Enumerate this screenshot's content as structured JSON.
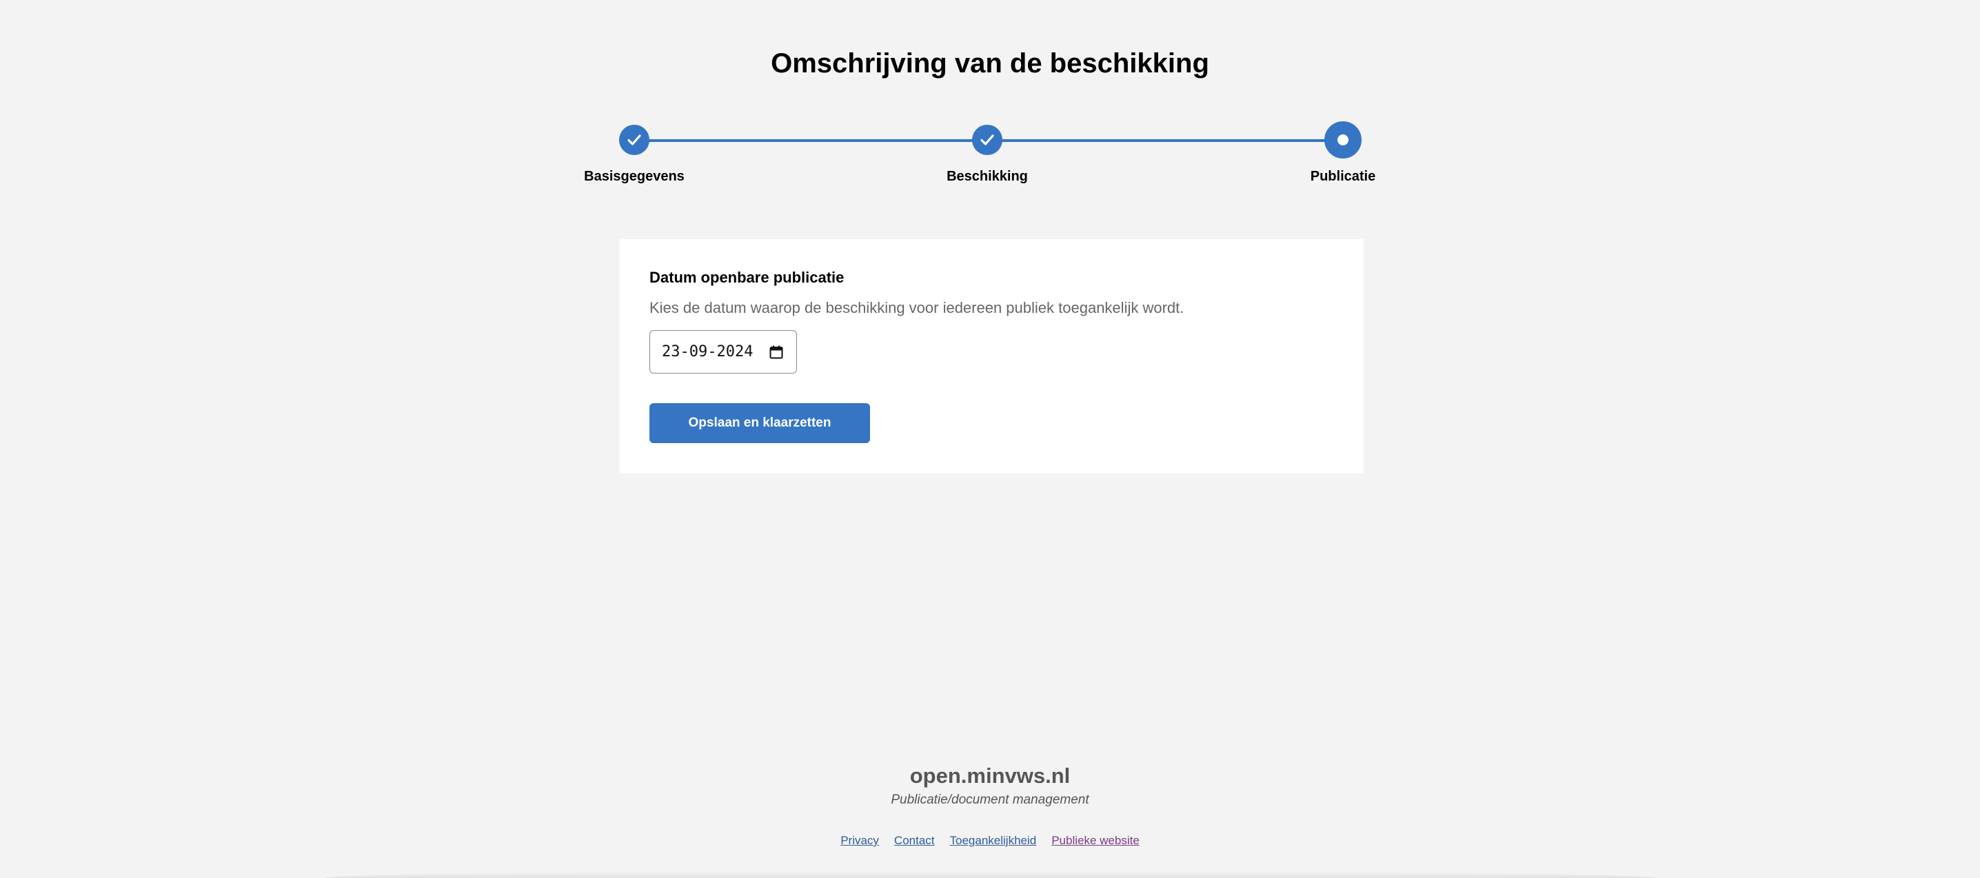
{
  "page": {
    "title": "Omschrijving van de beschikking"
  },
  "stepper": {
    "accent_color": "#3575c3",
    "steps": [
      {
        "label": "Basisgegevens",
        "state": "completed",
        "icon": "check-icon"
      },
      {
        "label": "Beschikking",
        "state": "completed",
        "icon": "check-icon"
      },
      {
        "label": "Publicatie",
        "state": "current",
        "icon": "current-dot-icon"
      }
    ]
  },
  "form": {
    "label": "Datum openbare publicatie",
    "help": "Kies de datum waarop de beschikking voor iedereen publiek toegankelijk wordt.",
    "date_value": "23-09-2024",
    "date_icon": "calendar-icon",
    "submit_label": "Opslaan en klaarzetten"
  },
  "footer": {
    "brand": "open.minvws.nl",
    "subtitle": "Publicatie/document management",
    "links": [
      {
        "label": "Privacy"
      },
      {
        "label": "Contact"
      },
      {
        "label": "Toegankelijkheid"
      },
      {
        "label": "Publieke website"
      }
    ]
  }
}
